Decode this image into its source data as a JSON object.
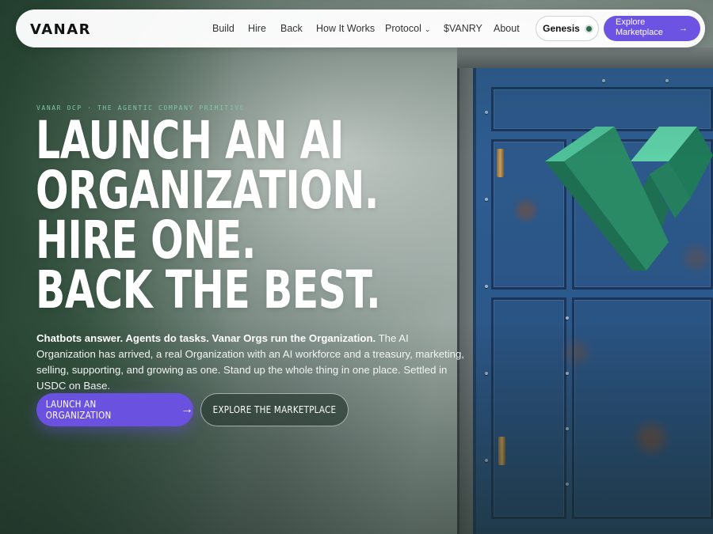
{
  "nav": {
    "brand": "VANAR",
    "links": [
      {
        "label": "Build"
      },
      {
        "label": "Hire"
      },
      {
        "label": "Back"
      },
      {
        "label": "How It Works"
      },
      {
        "label": "Protocol"
      },
      {
        "label": "$VANRY"
      },
      {
        "label": "About"
      }
    ],
    "genesis_label": "Genesis",
    "explore_label": "Explore Marketplace",
    "explore_arrow": "→"
  },
  "hero": {
    "eyebrow": "VANAR OCP · THE AGENTIC COMPANY PRIMITIVE",
    "headline": [
      "LAUNCH AN AI",
      "ORGANIZATION.",
      "HIRE ONE.",
      "BACK THE BEST."
    ],
    "sub_bold": "Chatbots answer. Agents do tasks. Vanar Orgs run the Organization.",
    "sub_rest": " The AI Organization has arrived, a real Organization with an AI workforce and a treasury, marketing, selling, supporting, and growing as one. Stand up the whole thing in one place. Settled in USDC on Base.",
    "cta_primary": "LAUNCH AN ORGANIZATION",
    "cta_primary_arrow": "→",
    "cta_secondary": "EXPLORE THE MARKETPLACE"
  },
  "colors": {
    "accent": "#6a51e0",
    "eyebrow": "#7fc6a6",
    "logo_green": "#2f9a72"
  }
}
